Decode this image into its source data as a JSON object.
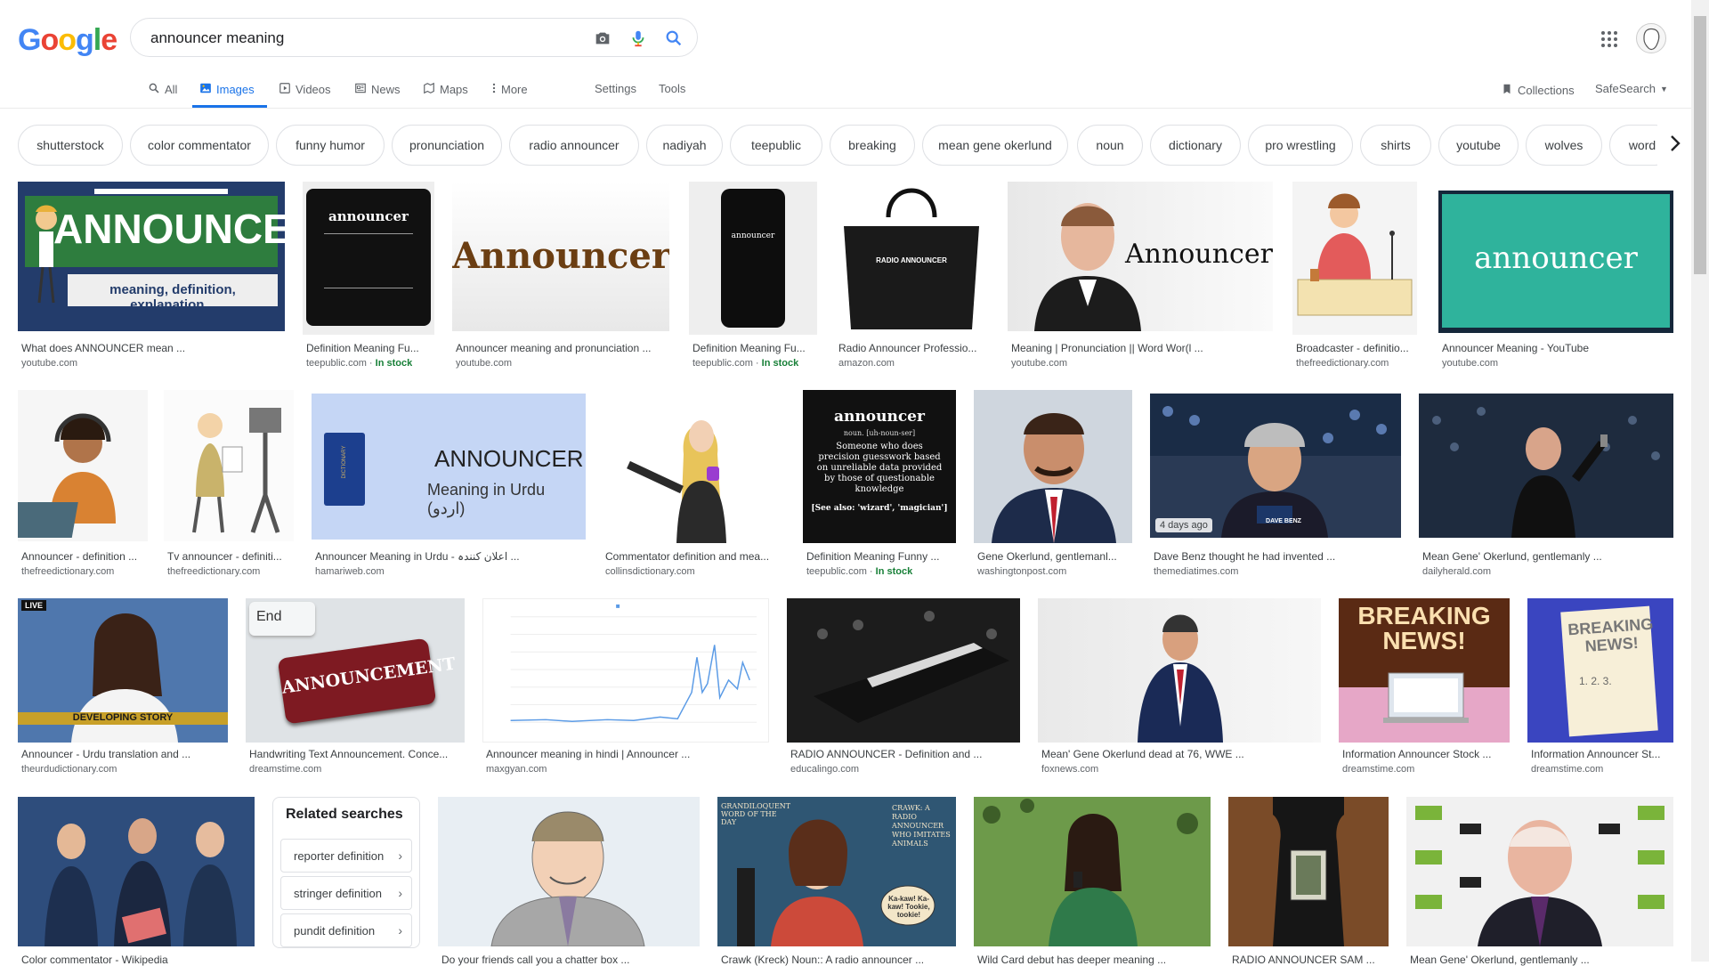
{
  "logo": {
    "letters": [
      "G",
      "o",
      "o",
      "g",
      "l",
      "e"
    ],
    "colors": [
      "#4285f4",
      "#ea4335",
      "#fbbc05",
      "#4285f4",
      "#34a853",
      "#ea4335"
    ]
  },
  "search": {
    "value": "announcer meaning"
  },
  "tabs": [
    {
      "label": "All",
      "icon": "search-icon"
    },
    {
      "label": "Images",
      "icon": "image-icon"
    },
    {
      "label": "Videos",
      "icon": "video-icon"
    },
    {
      "label": "News",
      "icon": "news-icon"
    },
    {
      "label": "Maps",
      "icon": "map-icon"
    },
    {
      "label": "More",
      "icon": "more-vert-icon"
    },
    {
      "label": "Settings"
    },
    {
      "label": "Tools"
    }
  ],
  "collections_label": "Collections",
  "safesearch_label": "SafeSearch",
  "chips": [
    "shutterstock",
    "color commentator",
    "funny humor",
    "pronunciation",
    "radio announcer",
    "nadiyah",
    "teepublic",
    "breaking",
    "mean gene okerlund",
    "noun",
    "dictionary",
    "pro wrestling",
    "shirts",
    "youtube",
    "wolves",
    "word"
  ],
  "results": [
    {
      "title": "What does ANNOUNCER mean ...",
      "source": "youtube.com",
      "thumb_text": "ANNOUNCER",
      "thumb_sub": "meaning, definition, explanation..."
    },
    {
      "title": "Definition Meaning Fu...",
      "source": "teepublic.com",
      "stock": "In stock",
      "thumb_text": "announcer",
      "thumb_sub": "noun. [uh-noun-ser]"
    },
    {
      "title": "Announcer meaning and pronunciation ...",
      "source": "youtube.com",
      "thumb_text": "Announcer"
    },
    {
      "title": "Definition Meaning Fu...",
      "source": "teepublic.com",
      "stock": "In stock",
      "thumb_text": "announcer"
    },
    {
      "title": "Radio Announcer Professio...",
      "source": "amazon.com",
      "thumb_text": "RADIO ANNOUNCER"
    },
    {
      "title": "Meaning | Pronunciation || Word Wor(l ...",
      "source": "youtube.com",
      "thumb_text": "Announcer"
    },
    {
      "title": "Broadcaster - definitio...",
      "source": "thefreedictionary.com"
    },
    {
      "title": "Announcer Meaning - YouTube",
      "source": "youtube.com",
      "thumb_text": "announcer"
    },
    {
      "title": "Announcer - definition ...",
      "source": "thefreedictionary.com"
    },
    {
      "title": "Tv announcer - definiti...",
      "source": "thefreedictionary.com"
    },
    {
      "title": "Announcer Meaning in Urdu - اعلان کنندہ ...",
      "source": "hamariweb.com",
      "thumb_text": "ANNOUNCER",
      "thumb_sub": "Meaning in Urdu (اردو)",
      "thumb_book": "DICTIONARY"
    },
    {
      "title": "Commentator definition and mea...",
      "source": "collinsdictionary.com"
    },
    {
      "title": "Definition Meaning Funny ...",
      "source": "teepublic.com",
      "stock": "In stock",
      "thumb_text": "announcer",
      "thumb_sub": "noun. [uh-noun-ser]",
      "thumb_body": "Someone who does precision guesswork based on unreliable data provided by those of questionable knowledge",
      "thumb_foot": "[See also: 'wizard', 'magician']"
    },
    {
      "title": "Gene Okerlund, gentlemanl...",
      "source": "washingtonpost.com"
    },
    {
      "title": "Dave Benz thought he had invented ...",
      "source": "themediatimes.com",
      "badge": "4 days ago",
      "thumb_text": "DAVE BENZ"
    },
    {
      "title": "Mean Gene' Okerlund, gentlemanly ...",
      "source": "dailyherald.com"
    },
    {
      "title": "Announcer - Urdu translation and ...",
      "source": "theurdudictionary.com",
      "thumb_text": "DEVELOPING STORY",
      "thumb_sub": "LIVE"
    },
    {
      "title": "Handwriting Text Announcement. Conce...",
      "source": "dreamstime.com",
      "thumb_text": "ANNOUNCEMENT",
      "thumb_sub": "End"
    },
    {
      "title": "Announcer meaning in hindi | Announcer ...",
      "source": "maxgyan.com"
    },
    {
      "title": "RADIO ANNOUNCER - Definition and ...",
      "source": "educalingo.com"
    },
    {
      "title": "Mean' Gene Okerlund dead at 76, WWE ...",
      "source": "foxnews.com"
    },
    {
      "title": "Information Announcer Stock ...",
      "source": "dreamstime.com",
      "thumb_text": "BREAKING NEWS!"
    },
    {
      "title": "Information Announcer St...",
      "source": "dreamstime.com",
      "thumb_text": "BREAKING NEWS!",
      "thumb_sub": "1. 2. 3."
    },
    {
      "title": "Color commentator - Wikipedia",
      "source": ""
    },
    {
      "title": "Do your friends call you a chatter box ...",
      "source": ""
    },
    {
      "title": "Crawk (Kreck) Noun:: A radio announcer ...",
      "source": "",
      "thumb_text": "CRAWK: A RADIO ANNOUNCER WHO IMITATES ANIMALS",
      "thumb_sub": "Ka-kaw! Ka-kaw! Tookie, tookie!",
      "thumb_corner": "GRANDILOQUENT WORD OF THE DAY"
    },
    {
      "title": "Wild Card debut has deeper meaning ...",
      "source": ""
    },
    {
      "title": "RADIO ANNOUNCER SAM ...",
      "source": ""
    },
    {
      "title": "Mean Gene' Okerlund, gentlemanly ...",
      "source": ""
    }
  ],
  "related": {
    "heading": "Related searches",
    "items": [
      "reporter definition",
      "stringer definition",
      "pundit definition"
    ]
  },
  "colors": {
    "accent": "#1a73e8",
    "stock_green": "#188038"
  }
}
